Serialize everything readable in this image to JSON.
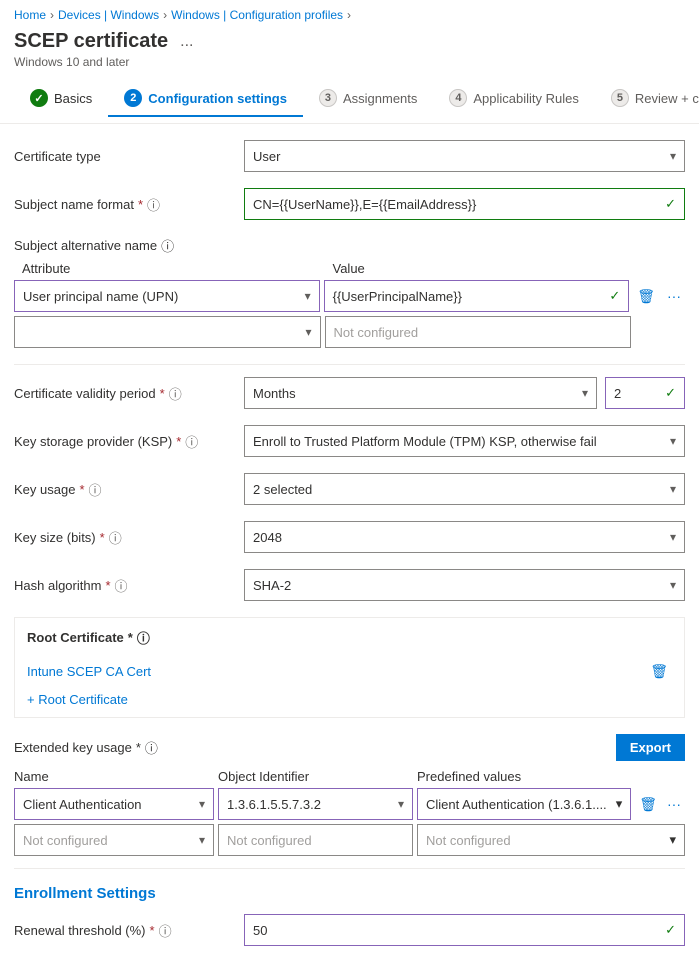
{
  "breadcrumb": {
    "items": [
      "Home",
      "Devices | Windows",
      "Windows | Configuration profiles"
    ]
  },
  "page": {
    "title": "SCEP certificate",
    "subtitle": "Windows 10 and later",
    "ellipsis": "..."
  },
  "tabs": [
    {
      "id": "basics",
      "label": "Basics",
      "state": "done",
      "number": "✓"
    },
    {
      "id": "config",
      "label": "Configuration settings",
      "state": "active",
      "number": "2"
    },
    {
      "id": "assignments",
      "label": "Assignments",
      "state": "pending",
      "number": "3"
    },
    {
      "id": "applicability",
      "label": "Applicability Rules",
      "state": "pending",
      "number": "4"
    },
    {
      "id": "review",
      "label": "Review + create",
      "state": "pending",
      "number": "5"
    }
  ],
  "form": {
    "certificate_type_label": "Certificate type",
    "certificate_type_value": "User",
    "subject_name_format_label": "Subject name format",
    "subject_name_format_required": "*",
    "subject_name_format_value": "CN={{UserName}},E={{EmailAddress}}",
    "subject_alt_name_label": "Subject alternative name",
    "san_attribute_header": "Attribute",
    "san_value_header": "Value",
    "san_rows": [
      {
        "attribute": "User principal name (UPN)",
        "value": "{{UserPrincipalName}}",
        "validated": true
      },
      {
        "attribute": "",
        "value": "Not configured",
        "validated": false
      }
    ],
    "cert_validity_label": "Certificate validity period",
    "cert_validity_required": "*",
    "cert_validity_period": "Months",
    "cert_validity_number": "2",
    "ksp_label": "Key storage provider (KSP)",
    "ksp_required": "*",
    "ksp_value": "Enroll to Trusted Platform Module (TPM) KSP, otherwise fail",
    "key_usage_label": "Key usage",
    "key_usage_required": "*",
    "key_usage_value": "2 selected",
    "key_size_label": "Key size (bits)",
    "key_size_required": "*",
    "key_size_value": "2048",
    "hash_algorithm_label": "Hash algorithm",
    "hash_algorithm_required": "*",
    "hash_algorithm_value": "SHA-2",
    "root_cert_section_title": "Root Certificate",
    "root_cert_required": "*",
    "root_cert_name": "Intune SCEP CA Cert",
    "add_root_cert_label": "+ Root Certificate",
    "eku_label": "Extended key usage",
    "eku_required": "*",
    "export_btn_label": "Export",
    "eku_col_name": "Name",
    "eku_col_oid": "Object Identifier",
    "eku_col_predef": "Predefined values",
    "eku_rows": [
      {
        "name": "Client Authentication",
        "oid": "1.3.6.1.5.5.7.3.2",
        "predef": "Client Authentication (1.3.6.1....",
        "validated": true
      },
      {
        "name": "Not configured",
        "oid": "Not configured",
        "predef": "Not configured",
        "validated": false
      }
    ],
    "enrollment_section_title": "Enrollment Settings",
    "renewal_threshold_label": "Renewal threshold (%)",
    "renewal_threshold_required": "*",
    "renewal_threshold_value": "50"
  },
  "icons": {
    "chevron_down": "▾",
    "check": "✓",
    "trash": "🗑",
    "ellipsis": "···",
    "plus": "+",
    "info": "ⓘ"
  }
}
